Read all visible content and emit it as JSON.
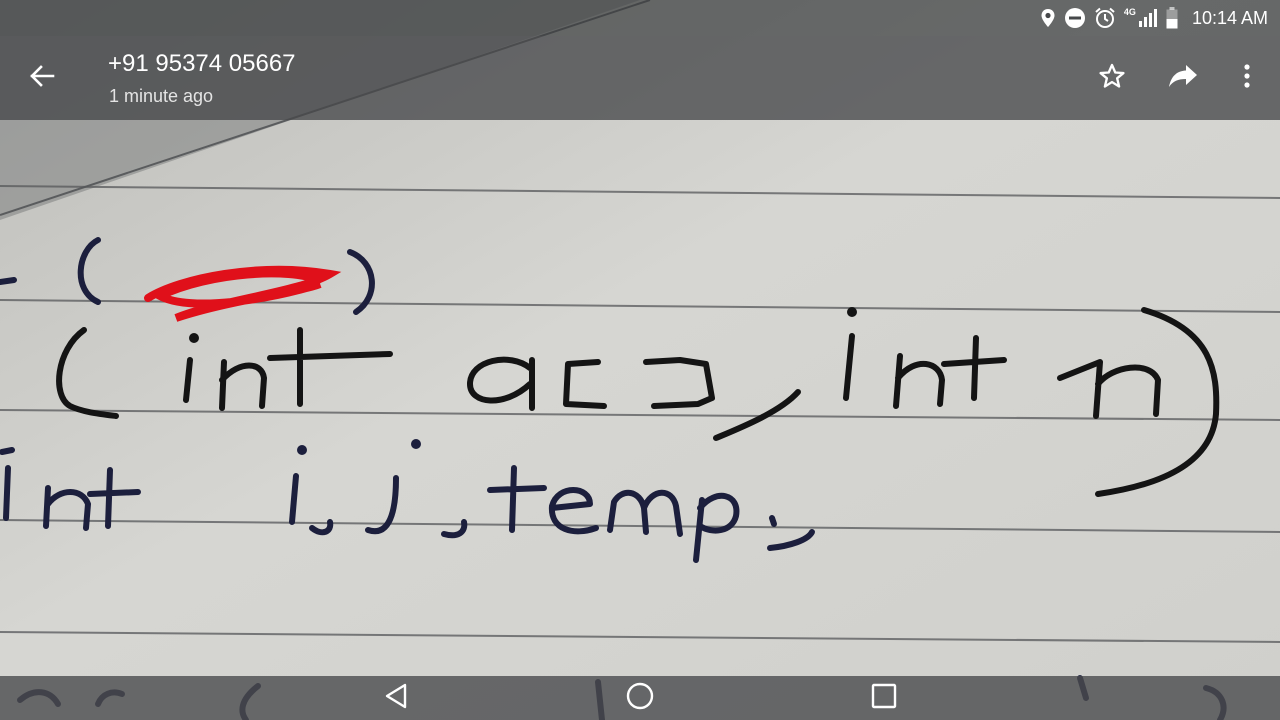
{
  "status_bar": {
    "icons": [
      "location-icon",
      "do-not-disturb-icon",
      "alarm-icon",
      "signal-4g-icon",
      "battery-icon"
    ],
    "network_label": "4G",
    "time": "10:14 AM"
  },
  "header": {
    "back_icon": "arrow-back-icon",
    "contact": "+91 95374 05667",
    "subtitle": "1 minute ago",
    "actions": [
      "star-icon",
      "share-icon",
      "more-vert-icon"
    ]
  },
  "photo": {
    "handwritten_lines": [
      "- (       )",
      "(int a[], int n)",
      "int  i,j,temp;"
    ]
  },
  "nav_bar": {
    "icons": [
      "nav-back-icon",
      "nav-home-icon",
      "nav-recents-icon"
    ]
  },
  "colors": {
    "bar_overlay": "#47494b",
    "paper": "#d4d4d0",
    "ink_black": "#141414",
    "ink_blue": "#1c1f3d",
    "scribble_red": "#e0101a"
  }
}
